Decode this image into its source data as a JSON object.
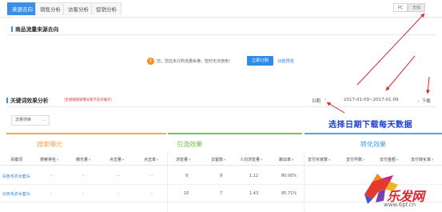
{
  "tabs": [
    {
      "label": "来源去向",
      "active": true
    },
    {
      "label": "销售分析"
    },
    {
      "label": "访客分析"
    },
    {
      "label": "促销分析"
    }
  ],
  "device_toggle": {
    "pc": "PC",
    "wireless": "无线"
  },
  "source_section": {
    "title": "商品流量来源去向",
    "notice": "您，您还未订购流量纵横，暂时无法使用！",
    "order_button": "立即订购",
    "feature_link": "功能预览"
  },
  "keyword_section": {
    "title": "关键词效果分析",
    "hint": "（无线端搜索曝光暂不支持展示）",
    "date_label": "日期",
    "date_range": "2017-01-09~2017-01-09",
    "download": "下载",
    "annotation": "选择日期下载每天数据",
    "dropdown": "流量搜索"
  },
  "groups": {
    "search": "搜索曝光",
    "traffic": "引流效果",
    "conversion": "转化效果"
  },
  "table": {
    "headers": [
      "关键词",
      "搜索排名",
      "曝光量",
      "点击量",
      "点击率",
      "浏览量",
      "访客数",
      "人均浏览量",
      "跳出率",
      "支付买家数",
      "支付件数",
      "支付金额",
      "支付转化率"
    ],
    "rows": [
      [
        "白色毛衣女套头",
        "-",
        "-",
        "-",
        "-",
        "9",
        "9",
        "1.12",
        "80.00%",
        "",
        "",
        "",
        ""
      ],
      [
        "白色毛衣女套头",
        "-",
        "-",
        "-",
        "-",
        "10",
        "7",
        "1.43",
        "85.71%",
        "",
        "",
        "",
        ""
      ]
    ]
  },
  "watermark": {
    "text": "乐发网",
    "url": "www.6pf.cn"
  },
  "colors": {
    "accent": "#3a8ee6",
    "search": "#f4a84a",
    "traffic": "#7bc653",
    "conversion": "#4fa7e8",
    "annotation": "#1a3fd6",
    "arrow": "#d9272d"
  }
}
